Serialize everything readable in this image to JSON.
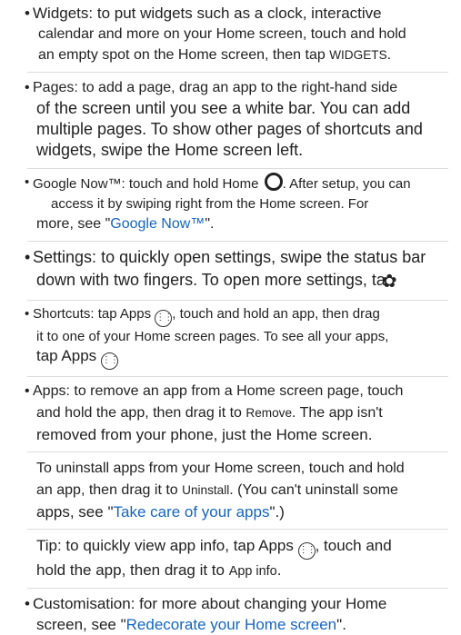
{
  "items": {
    "widgets": {
      "bullet": "•",
      "label": "Widgets:",
      "text_a": "to put widgets such as a clock, interactive",
      "text_b": "calendar and more on your Home screen, touch and hold",
      "text_c": "an empty spot on the Home screen, then tap",
      "ui_term": "WIDGETS",
      "end": "."
    },
    "pages": {
      "bullet": "•",
      "label": "Pages:",
      "text_a": "to add a page, drag an app to the right-hand side",
      "text_b": "of the screen until you see a white bar. You can add",
      "text_c": "multiple pages. To show other pages of shortcuts and",
      "text_d": "widgets, swipe the Home screen left."
    },
    "google_now": {
      "bullet": "•",
      "label": "Google Now™:",
      "text_a": "touch and hold Home",
      "text_b": ". After setup, you can",
      "text_c": "access it by swiping right from the Home screen. For",
      "text_d": "more, see \"",
      "link": "Google Now™",
      "text_e": "\"."
    },
    "settings": {
      "bullet": "•",
      "label": "Settings:",
      "text_a": "to quickly open settings, swipe the status bar",
      "text_b": "down with two fingers. To open more settings, ta",
      "icon": "gear-icon"
    },
    "shortcuts": {
      "bullet": "•",
      "label": "Shortcuts:",
      "text_a": "tap Apps",
      "text_b": ", touch and hold an app, then drag",
      "text_c": "it to one of your Home screen pages. To see all your apps,",
      "text_d": "tap Apps"
    },
    "apps": {
      "bullet": "•",
      "label": "Apps:",
      "text_a": "to remove an app from a Home screen page, touch",
      "text_b": "and hold the app, then drag it to",
      "ui_remove": "Remove",
      "text_c": ". The app isn't",
      "text_d": "removed from your phone, just the Home screen."
    },
    "uninstall": {
      "text_a": "To uninstall apps from your Home screen, touch and hold",
      "text_b": "an app, then drag it to",
      "ui_uninstall": "Uninstall",
      "text_c": ". (You can't uninstall some",
      "text_d": "apps, see \"",
      "link": "Take care of your apps",
      "text_e": "\".)"
    },
    "tip": {
      "text_a": "Tip: to quickly view app info, tap Apps",
      "text_b": ", touch and",
      "text_c": "hold the app, then drag it to",
      "ui_appinfo": "App info",
      "end": "."
    },
    "customisation": {
      "bullet": "•",
      "label": "Customisation:",
      "text_a": "for more about changing your Home",
      "text_b": "screen, see \"",
      "link": "Redecorate your Home screen",
      "text_c": "\"."
    }
  },
  "icons": {
    "home": "home-circle-icon",
    "apps": "apps-grid-icon",
    "gear": "gear-icon"
  },
  "colors": {
    "link": "#1565c0",
    "text": "#222222",
    "divider": "#dcdcdc"
  }
}
